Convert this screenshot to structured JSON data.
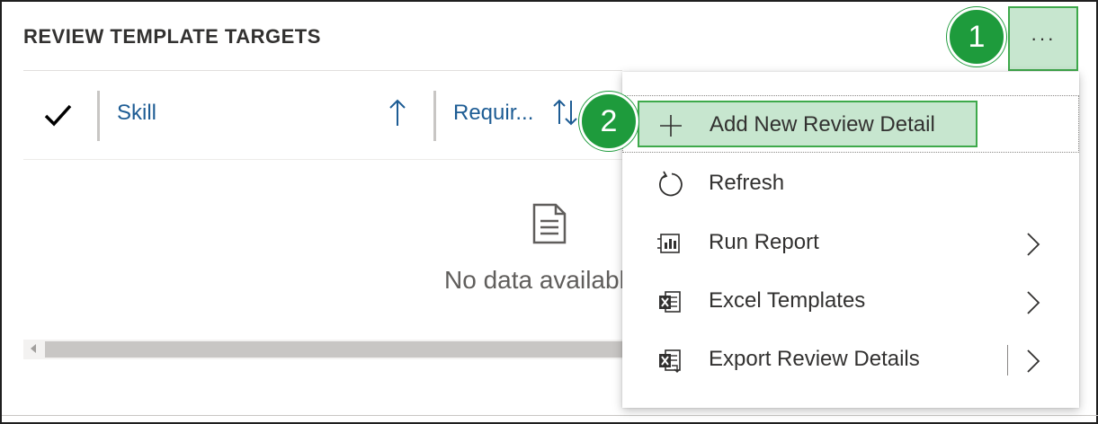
{
  "section": {
    "title": "REVIEW TEMPLATE TARGETS"
  },
  "grid": {
    "columns": [
      {
        "label": "Skill",
        "sort_icon": "sort-ascending-icon"
      },
      {
        "label": "Requir...",
        "sort_icon": "sort-both-icon"
      }
    ],
    "empty_message": "No data available"
  },
  "toolbar": {
    "more_label": "···"
  },
  "callouts": {
    "step1": "1",
    "step2": "2"
  },
  "menu": {
    "items": [
      {
        "label": "Add New Review Detail",
        "icon": "plus-icon"
      },
      {
        "label": "Refresh",
        "icon": "refresh-icon"
      },
      {
        "label": "Run Report",
        "icon": "report-icon",
        "submenu": true
      },
      {
        "label": "Excel Templates",
        "icon": "excel-icon",
        "submenu": true
      },
      {
        "label": "Export Review Details",
        "icon": "excel-export-icon",
        "submenu": true,
        "split": true
      }
    ]
  },
  "colors": {
    "accent_link": "#1d5c94",
    "callout_green": "#1e9b3c",
    "highlight_fill": "#c7e6cf",
    "highlight_border": "#3ea94b"
  }
}
